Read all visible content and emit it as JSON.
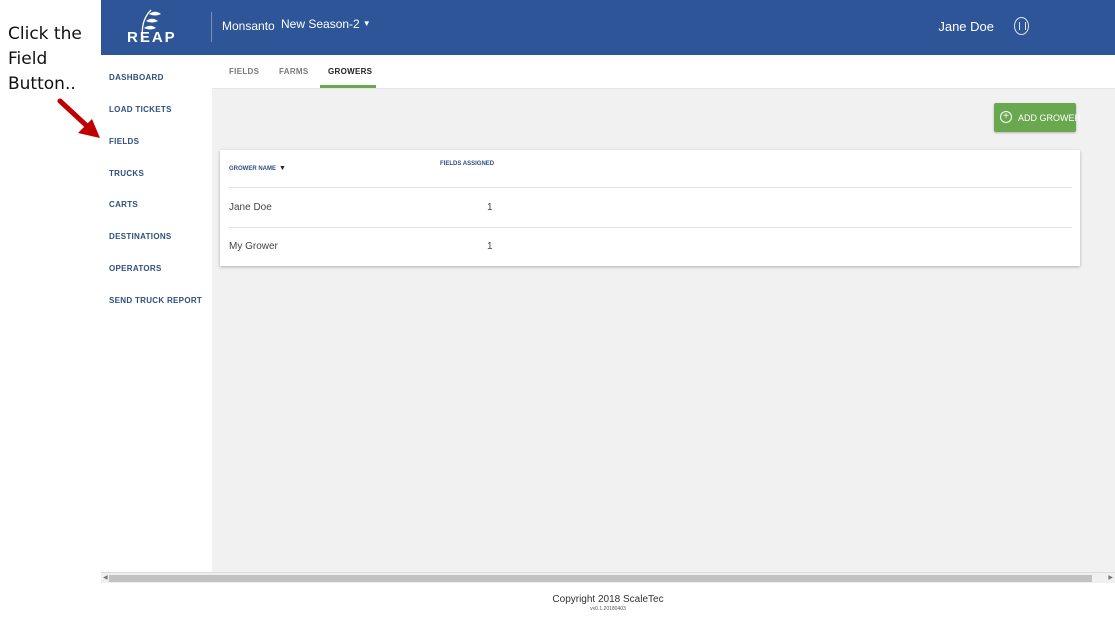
{
  "callout": {
    "line1": "Click the",
    "line2": "Field",
    "line3": "Button.."
  },
  "colors": {
    "header": "#2e5597",
    "accent": "#6aa84f",
    "nav_text": "#2e4f7f",
    "arrow": "#c00000"
  },
  "header": {
    "logo_text": "REAP",
    "organization": "Monsanto",
    "season": "New Season-2",
    "user_name": "Jane Doe",
    "user_icon": "user-profile-icon"
  },
  "sidebar": {
    "items": [
      {
        "label": "DASHBOARD"
      },
      {
        "label": "LOAD TICKETS"
      },
      {
        "label": "FIELDS"
      },
      {
        "label": "TRUCKS"
      },
      {
        "label": "CARTS"
      },
      {
        "label": "DESTINATIONS"
      },
      {
        "label": "OPERATORS"
      },
      {
        "label": "SEND TRUCK REPORT"
      }
    ]
  },
  "tabs": [
    {
      "label": "FIELDS"
    },
    {
      "label": "FARMS"
    },
    {
      "label": "GROWERS",
      "active": true
    }
  ],
  "add_button": {
    "label": "ADD GROWER",
    "icon": "add-circle-icon"
  },
  "table": {
    "columns": [
      "GROWER NAME",
      "FIELDS ASSIGNED"
    ],
    "rows": [
      {
        "name": "Jane Doe",
        "fields": "1"
      },
      {
        "name": "My Grower",
        "fields": "1"
      }
    ]
  },
  "footer": {
    "copyright": "Copyright 2018 ScaleTec",
    "version": "vv0.1.20180403"
  }
}
